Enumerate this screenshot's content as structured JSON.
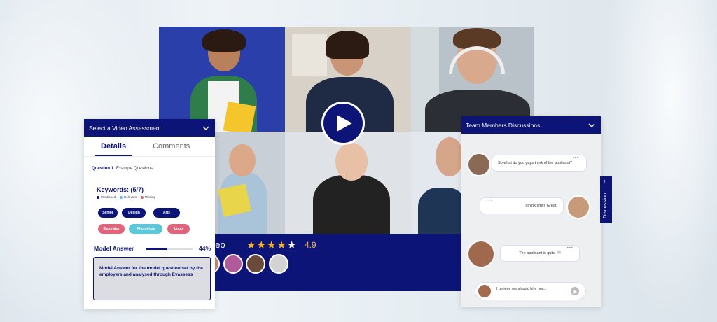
{
  "video": {
    "title_fragment": "deo",
    "stars": 4,
    "max_stars": 5,
    "rating": "4.9",
    "colors": {
      "navy": "#0c1577",
      "star": "#f5b51f"
    }
  },
  "left_panel": {
    "header": "Select a Video Assessment",
    "tabs": [
      "Details",
      "Comments"
    ],
    "question_label": "Question 1",
    "question_text": "Example Questions",
    "keywords_title": "Keywords: (5/7)",
    "legend": [
      "Mentioned",
      "Relevant",
      "Missing"
    ],
    "chips": [
      {
        "label": "Senior",
        "kind": "mentioned"
      },
      {
        "label": "Design",
        "kind": "mentioned"
      },
      {
        "label": "Arts",
        "kind": "mentioned"
      },
      {
        "label": "Illustrator",
        "kind": "missing"
      },
      {
        "label": "Photoshop",
        "kind": "relevant"
      },
      {
        "label": "Logo",
        "kind": "missing"
      }
    ],
    "model_answer_title": "Model Answer",
    "model_answer_progress": 0.44,
    "model_answer_pct": "44%",
    "model_answer_text": "Model Answer for the model question set by the employers and analysed through Evassess"
  },
  "right_panel": {
    "header": "Team Members Discussions",
    "messages": [
      "So what do you guys think of the applicant?",
      "I think she's Great!",
      "The applicant is quite !!!!"
    ],
    "input_text": "I believe we should hire her...",
    "side_tab": "Discussion"
  }
}
